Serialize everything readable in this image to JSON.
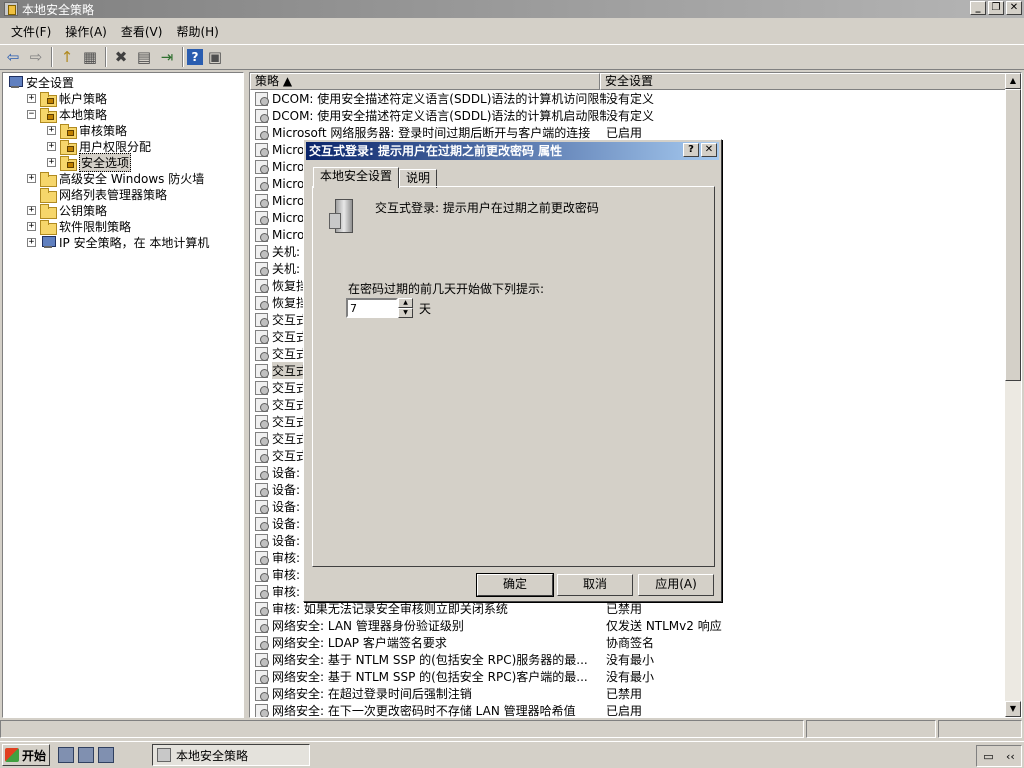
{
  "window": {
    "title": "本地安全策略",
    "buttons": {
      "minimize": "_",
      "maximize": "❐",
      "close": "✕"
    }
  },
  "menu": [
    "文件(F)",
    "操作(A)",
    "查看(V)",
    "帮助(H)"
  ],
  "toolbar": [
    {
      "name": "back-icon",
      "glyph": "⇦",
      "color": "#2a5db0"
    },
    {
      "name": "forward-icon",
      "glyph": "⇨",
      "color": "#808080"
    },
    {
      "name": "up-folder-icon",
      "glyph": "↑",
      "color": "#b08a20"
    },
    {
      "name": "show-hide-tree-icon",
      "glyph": "▦",
      "color": "#505050"
    },
    {
      "name": "delete-icon",
      "glyph": "✖",
      "color": "#404040"
    },
    {
      "name": "properties-icon",
      "glyph": "▤",
      "color": "#505050"
    },
    {
      "name": "export-list-icon",
      "glyph": "⇥",
      "color": "#307030"
    },
    {
      "name": "help-icon",
      "glyph": "?",
      "color": "#ffffff"
    },
    {
      "name": "console-tree-icon",
      "glyph": "▣",
      "color": "#505050"
    }
  ],
  "tree": [
    {
      "label": "安全设置",
      "indent": 0,
      "expander": "",
      "icon": "pc"
    },
    {
      "label": "帐户策略",
      "indent": 1,
      "expander": "+",
      "icon": "lock"
    },
    {
      "label": "本地策略",
      "indent": 1,
      "expander": "−",
      "icon": "lock"
    },
    {
      "label": "审核策略",
      "indent": 2,
      "expander": "+",
      "icon": "lock"
    },
    {
      "label": "用户权限分配",
      "indent": 2,
      "expander": "+",
      "icon": "lock"
    },
    {
      "label": "安全选项",
      "indent": 2,
      "expander": "+",
      "icon": "lock",
      "selected": true
    },
    {
      "label": "高级安全 Windows 防火墙",
      "indent": 1,
      "expander": "+",
      "icon": "folder"
    },
    {
      "label": "网络列表管理器策略",
      "indent": 1,
      "expander": "",
      "icon": "folder"
    },
    {
      "label": "公钥策略",
      "indent": 1,
      "expander": "+",
      "icon": "folder"
    },
    {
      "label": "软件限制策略",
      "indent": 1,
      "expander": "+",
      "icon": "folder"
    },
    {
      "label": "IP 安全策略，在 本地计算机",
      "indent": 1,
      "expander": "+",
      "icon": "pc"
    }
  ],
  "list": {
    "columns": [
      "策略 ▲",
      "安全设置"
    ],
    "rows": [
      {
        "policy": "DCOM: 使用安全描述符定义语言(SDDL)语法的计算机访问限制",
        "setting": "没有定义"
      },
      {
        "policy": "DCOM: 使用安全描述符定义语言(SDDL)语法的计算机启动限制",
        "setting": "没有定义"
      },
      {
        "policy": "Microsoft 网络服务器: 登录时间过期后断开与客户端的连接",
        "setting": "已启用"
      },
      {
        "policy": "Micro",
        "setting": ""
      },
      {
        "policy": "Micro",
        "setting": ""
      },
      {
        "policy": "Micro",
        "setting": ""
      },
      {
        "policy": "Micro",
        "setting": ""
      },
      {
        "policy": "Micro",
        "setting": ""
      },
      {
        "policy": "Micro",
        "setting": ""
      },
      {
        "policy": "关机:",
        "setting": ""
      },
      {
        "policy": "关机:",
        "setting": ""
      },
      {
        "policy": "恢复挡",
        "setting": ""
      },
      {
        "policy": "恢复挡",
        "setting": ""
      },
      {
        "policy": "交互式",
        "setting": ""
      },
      {
        "policy": "交互式",
        "setting": ""
      },
      {
        "policy": "交互式",
        "setting": ""
      },
      {
        "policy": "交互式",
        "setting": "",
        "selected": true
      },
      {
        "policy": "交互式",
        "setting": ""
      },
      {
        "policy": "交互式",
        "setting": ""
      },
      {
        "policy": "交互式",
        "setting": ""
      },
      {
        "policy": "交互式",
        "setting": ""
      },
      {
        "policy": "交互式",
        "setting": ""
      },
      {
        "policy": "设备:",
        "setting": ""
      },
      {
        "policy": "设备:",
        "setting": ""
      },
      {
        "policy": "设备:",
        "setting": ""
      },
      {
        "policy": "设备:",
        "setting": ""
      },
      {
        "policy": "设备:",
        "setting": ""
      },
      {
        "policy": "审核:",
        "setting": ""
      },
      {
        "policy": "审核:",
        "setting": ""
      },
      {
        "policy": "审核:",
        "setting": ""
      },
      {
        "policy": "审核: 如果无法记录安全审核则立即关闭系统",
        "setting": "已禁用"
      },
      {
        "policy": "网络安全: LAN 管理器身份验证级别",
        "setting": "仅发送 NTLMv2 响应"
      },
      {
        "policy": "网络安全: LDAP 客户端签名要求",
        "setting": "协商签名"
      },
      {
        "policy": "网络安全: 基于 NTLM SSP 的(包括安全 RPC)服务器的最...",
        "setting": "没有最小"
      },
      {
        "policy": "网络安全: 基于 NTLM SSP 的(包括安全 RPC)客户端的最...",
        "setting": "没有最小"
      },
      {
        "policy": "网络安全: 在超过登录时间后强制注销",
        "setting": "已禁用"
      },
      {
        "policy": "网络安全: 在下一次更改密码时不存储 LAN 管理器哈希值",
        "setting": "已启用"
      }
    ]
  },
  "dialog": {
    "title": "交互式登录: 提示用户在过期之前更改密码 属性",
    "help_btn": "?",
    "close_btn": "✕",
    "tabs": [
      "本地安全设置",
      "说明"
    ],
    "policy_name": "交互式登录: 提示用户在过期之前更改密码",
    "prompt_label": "在密码过期的前几天开始做下列提示:",
    "days_value": "7",
    "unit": "天",
    "buttons": {
      "ok": "确定",
      "cancel": "取消",
      "apply": "应用(A)"
    }
  },
  "taskbar": {
    "start": "开始",
    "task": "本地安全策略",
    "tray_glyph": "‹‹"
  }
}
